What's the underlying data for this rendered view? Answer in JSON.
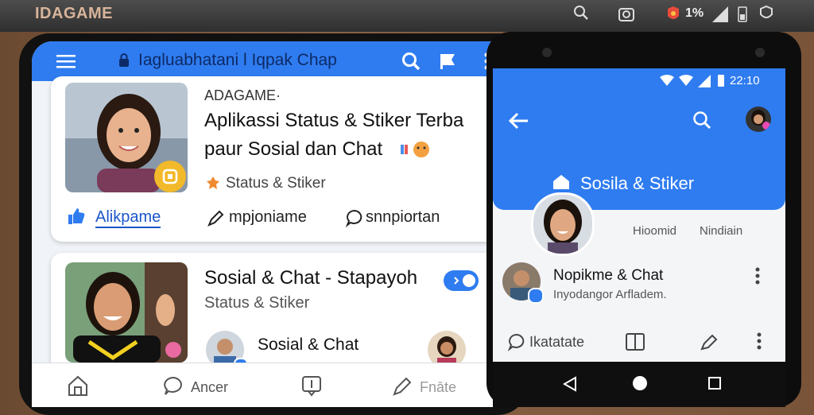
{
  "top_bar": {
    "brand": "IDAGAME",
    "battery_text": "1%"
  },
  "left_phone": {
    "app_title": "Iagluabhatani l Iqpak Chap",
    "card1": {
      "brand": "ADAGAME·",
      "headline_line1": "Aplikassi Status & Stiker Terba",
      "headline_line2": "paur Sosial dan Chat",
      "category": "Status & Stiker",
      "action_like": "Alikpame",
      "action_share": "mpjoniame",
      "action_comment": "snnpiortan"
    },
    "card2": {
      "title": "Sosial & Chat - Stapayoh",
      "subtitle": "Status & Stiker",
      "user_label": "Sosial & Chat"
    },
    "bottom_nav": {
      "item2": "Ancer",
      "item4": "Fnāte"
    }
  },
  "right_phone": {
    "status_time": "22:10",
    "header_title": "Sosila & Stiker",
    "profile_stat1": "Hioomid",
    "profile_stat2": "Nindiain",
    "list_item_title": "Nopikme & Chat",
    "list_item_subtitle": "Inyodangor Arfladem.",
    "action_comment": "Ikatatate"
  },
  "colors": {
    "primary_blue": "#2f7cf0",
    "brand_orange": "#d8b49a",
    "badge_yellow": "#f2b92a"
  },
  "icons": [
    "menu-icon",
    "lock-icon",
    "search-icon",
    "flag-icon",
    "more-icon",
    "like-icon",
    "share-icon",
    "comment-icon",
    "home-icon",
    "add-icon",
    "back-icon",
    "verified-icon"
  ]
}
